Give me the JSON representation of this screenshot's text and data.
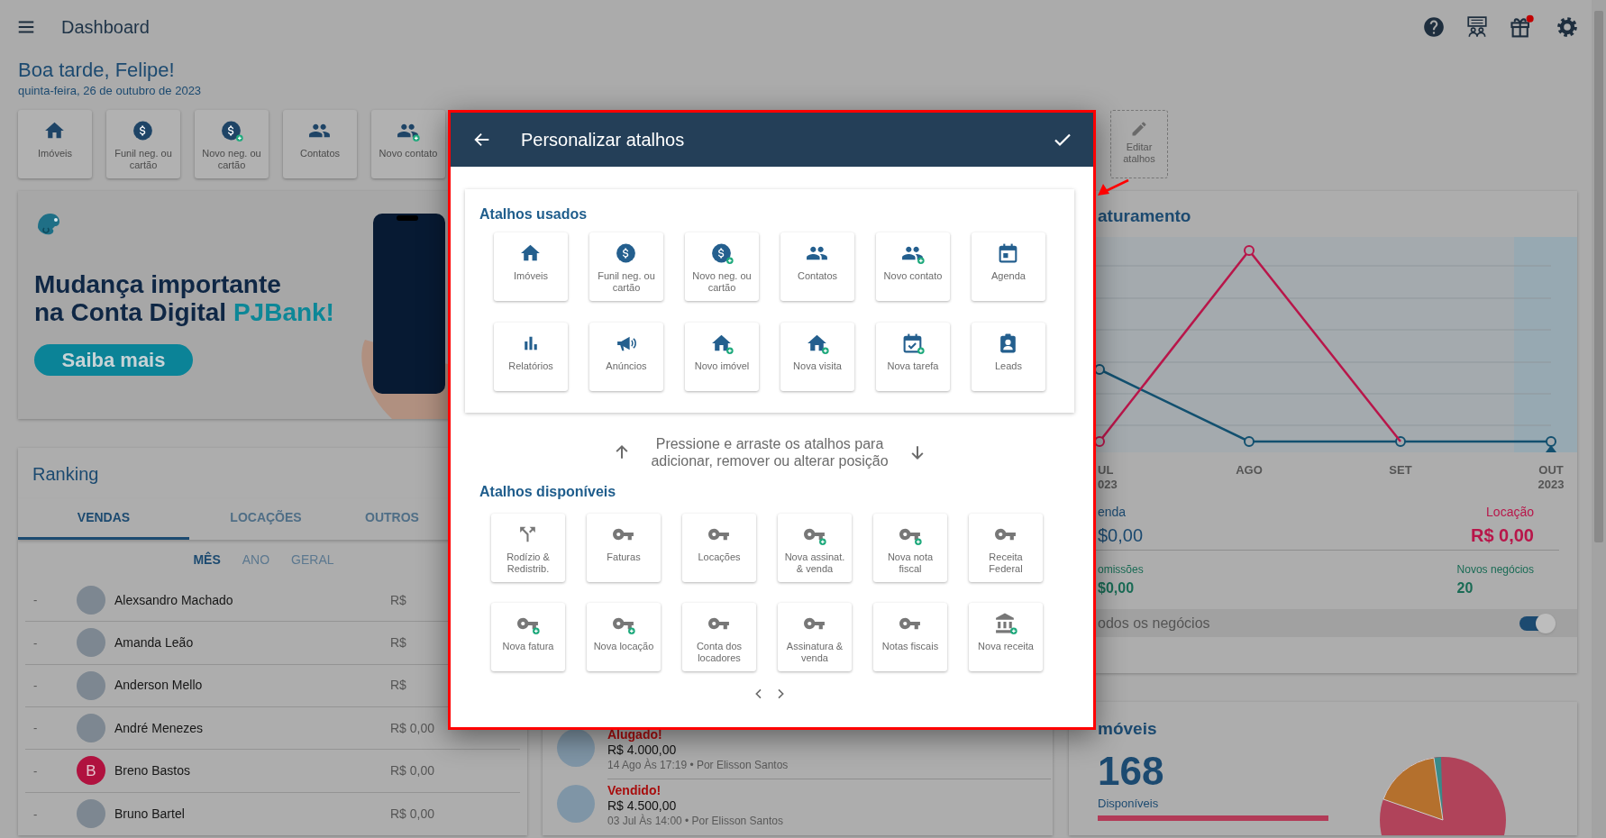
{
  "top_bar": {
    "title": "Dashboard"
  },
  "greeting": {
    "title": "Boa tarde, Felipe!",
    "date": "quinta-feira, 26 de outubro de 2023"
  },
  "shortcuts": [
    {
      "label": "Imóveis"
    },
    {
      "label": "Funil neg. ou cartão"
    },
    {
      "label": "Novo neg. ou cartão"
    },
    {
      "label": "Contatos"
    },
    {
      "label": "Novo contato"
    }
  ],
  "edit_shortcuts": {
    "label": "Editar atalhos"
  },
  "banner": {
    "headline_1": "Mudança importante",
    "headline_2": "na Conta Digital",
    "brand": "PJBank!",
    "button": "Saiba mais"
  },
  "ranking": {
    "title": "Ranking",
    "tabs": [
      {
        "label": "VENDAS",
        "selected": true
      },
      {
        "label": "LOCAÇÕES",
        "selected": false
      },
      {
        "label": "OUTROS",
        "selected": false
      }
    ],
    "periods": [
      {
        "label": "MÊS",
        "selected": true
      },
      {
        "label": "ANO",
        "selected": false
      },
      {
        "label": "GERAL",
        "selected": false
      }
    ],
    "rows": [
      {
        "position": "-",
        "name": "Alexsandro Machado",
        "amount": "R$"
      },
      {
        "position": "-",
        "name": "Amanda Leão",
        "amount": "R$"
      },
      {
        "position": "-",
        "name": "Anderson Mello",
        "amount": "R$"
      },
      {
        "position": "-",
        "name": "André Menezes",
        "amount": "R$ 0,00"
      },
      {
        "position": "-",
        "initial": "B",
        "name": "Breno Bastos",
        "amount": "R$ 0,00"
      },
      {
        "position": "-",
        "name": "Bruno Bartel",
        "amount": "R$ 0,00"
      }
    ]
  },
  "activity": [
    {
      "status": "Alugado!",
      "amount": "R$ 4.000,00",
      "meta": "14 Ago Às 17:19 • Por Elisson Santos"
    },
    {
      "status": "Vendido!",
      "amount": "R$ 4.500,00",
      "meta": "03 Jul Às 14:00 • Por Elisson Santos"
    }
  ],
  "revenue": {
    "title": "aturamento",
    "x_labels": [
      {
        "month": "UL",
        "year": "023"
      },
      {
        "month": "AGO"
      },
      {
        "month": "SET"
      },
      {
        "month": "OUT",
        "year": "2023"
      }
    ],
    "sale": {
      "label": "enda",
      "value": "$0,00"
    },
    "rent": {
      "label": "Locação",
      "value": "R$ 0,00"
    },
    "commission": {
      "label": "omissões",
      "value": "$0,00"
    },
    "new_deals": {
      "label": "Novos negócios",
      "value": "20"
    },
    "all_deals": {
      "label": "odos os negócios",
      "on": true
    }
  },
  "properties": {
    "title": "móveis",
    "count": "168",
    "caption": "Disponíveis"
  },
  "dialog": {
    "title": "Personalizar atalhos",
    "used_title": "Atalhos usados",
    "used": [
      "Imóveis",
      "Funil neg. ou cartão",
      "Novo neg. ou cartão",
      "Contatos",
      "Novo contato",
      "Agenda",
      "Relatórios",
      "Anúncios",
      "Novo imóvel",
      "Nova visita",
      "Nova tarefa",
      "Leads"
    ],
    "hint": "Pressione e arraste os atalhos para adicionar, remover ou alterar posição",
    "available_title": "Atalhos disponíveis",
    "available": [
      "Rodízio & Redistrib.",
      "Faturas",
      "Locações",
      "Nova assinat. & venda",
      "Nova nota fiscal",
      "Receita Federal",
      "Nova fatura",
      "Nova locação",
      "Conta dos locadores",
      "Assinatura & venda",
      "Notas fiscais",
      "Nova receita"
    ]
  }
}
